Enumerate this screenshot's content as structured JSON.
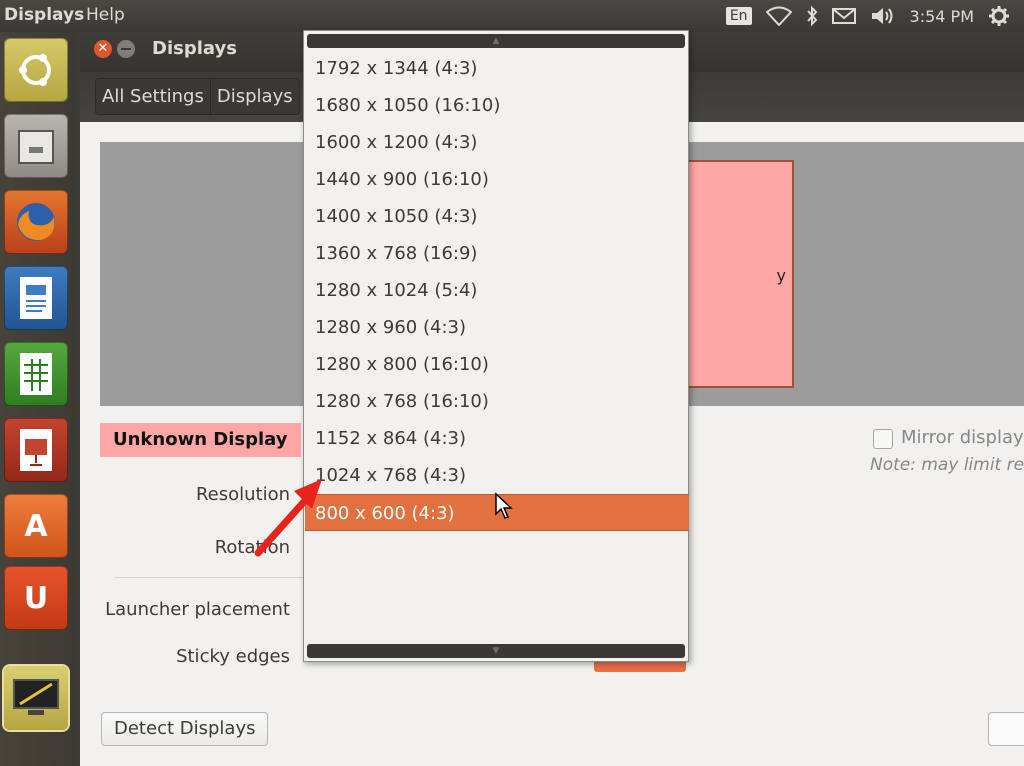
{
  "topbar": {
    "app_menu": "Displays",
    "help_menu": "Help",
    "lang": "En",
    "clock": "3:54 PM"
  },
  "launcher": {
    "items": [
      "ubuntu-dash",
      "files",
      "firefox",
      "libreoffice-writer",
      "libreoffice-calc",
      "libreoffice-impress",
      "software-center",
      "amazon",
      "displays-settings"
    ]
  },
  "window": {
    "title": "Displays",
    "breadcrumbs": [
      "All Settings",
      "Displays"
    ]
  },
  "display": {
    "name": "Unknown Display",
    "monitor_label": "y",
    "mirror_label": "Mirror display",
    "note": "Note: may limit res"
  },
  "form": {
    "resolution_label": "Resolution",
    "rotation_label": "Rotation",
    "launcher_placement_label": "Launcher placement",
    "sticky_edges_label": "Sticky edges"
  },
  "buttons": {
    "detect": "Detect Displays"
  },
  "dropdown": {
    "options": [
      "1792 x 1344 (4:3)",
      "1680 x 1050 (16:10)",
      "1600 x 1200 (4:3)",
      "1440 x 900 (16:10)",
      "1400 x 1050 (4:3)",
      "1360 x 768 (16:9)",
      "1280 x 1024 (5:4)",
      "1280 x 960 (4:3)",
      "1280 x 800 (16:10)",
      "1280 x 768 (16:10)",
      "1152 x 864 (4:3)",
      "1024 x 768 (4:3)",
      "800 x 600 (4:3)"
    ],
    "selected": "800 x 600 (4:3)"
  },
  "colors": {
    "accent": "#e3713f",
    "monitor_fill": "#ffa7a7",
    "annotation_arrow": "#e8231a"
  }
}
